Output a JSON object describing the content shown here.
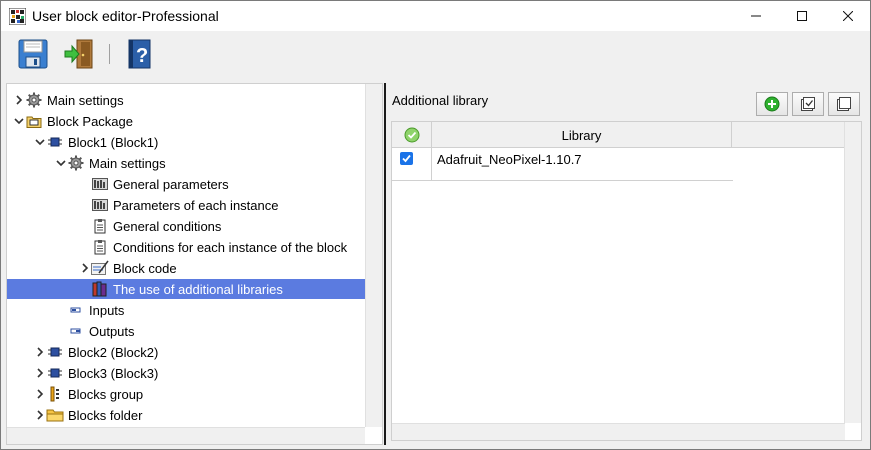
{
  "window": {
    "title": "User block editor-Professional",
    "minimize_glyph": "—",
    "maximize_glyph": "☐",
    "close_glyph": "✕"
  },
  "toolbar": {
    "items": [
      {
        "name": "save-icon"
      },
      {
        "name": "exit-door-icon"
      },
      {
        "name": "help-book-icon"
      }
    ]
  },
  "tree": {
    "items": [
      {
        "label": "Main settings",
        "icon": "gear-icon",
        "chevron": "›",
        "level": 0
      },
      {
        "label": "Block Package",
        "icon": "package-folder-icon",
        "chevron": "⌄",
        "level": 0
      },
      {
        "label": "Block1 (Block1)",
        "icon": "block-chip-icon",
        "chevron": "⌄",
        "level": 1
      },
      {
        "label": "Main settings",
        "icon": "gear-icon",
        "chevron": "⌄",
        "level": 2
      },
      {
        "label": "General parameters",
        "icon": "parameters-icon",
        "chevron": "",
        "level": 3
      },
      {
        "label": "Parameters of each instance",
        "icon": "parameters-icon",
        "chevron": "",
        "level": 3
      },
      {
        "label": "General conditions",
        "icon": "clipboard-icon",
        "chevron": "",
        "level": 3
      },
      {
        "label": "Conditions for each instance of the block",
        "icon": "clipboard-icon",
        "chevron": "",
        "level": 3
      },
      {
        "label": "Block code",
        "icon": "code-edit-icon",
        "chevron": "›",
        "level": 3
      },
      {
        "label": "The use of additional libraries",
        "icon": "library-books-icon",
        "chevron": "",
        "level": 3,
        "selected": true
      },
      {
        "label": "Inputs",
        "icon": "input-port-icon",
        "chevron": "",
        "level": 2
      },
      {
        "label": "Outputs",
        "icon": "output-port-icon",
        "chevron": "",
        "level": 2
      },
      {
        "label": "Block2 (Block2)",
        "icon": "block-chip-icon",
        "chevron": "›",
        "level": 1
      },
      {
        "label": "Block3 (Block3)",
        "icon": "block-chip-icon",
        "chevron": "›",
        "level": 1
      },
      {
        "label": "Blocks group",
        "icon": "blocks-group-icon",
        "chevron": "›",
        "level": 1
      },
      {
        "label": "Blocks folder",
        "icon": "folder-icon",
        "chevron": "›",
        "level": 1
      }
    ]
  },
  "right_panel": {
    "title": "Additional library",
    "buttons": [
      {
        "name": "add-library-button",
        "icon": "plus-circle-icon"
      },
      {
        "name": "check-all-button",
        "icon": "check-all-icon"
      },
      {
        "name": "copy-button",
        "icon": "copy-icon"
      }
    ],
    "grid": {
      "columns": [
        "",
        "Library"
      ],
      "rows": [
        {
          "checked": true,
          "library": "Adafruit_NeoPixel-1.10.7"
        }
      ]
    }
  },
  "colors": {
    "selection": "#5b7be0",
    "checkbox": "#1a73e8",
    "add_green": "#2fb12f"
  }
}
